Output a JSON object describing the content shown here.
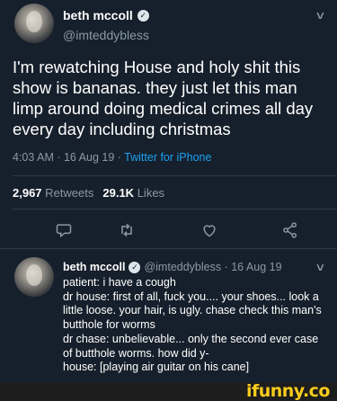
{
  "tweet": {
    "author_name": "beth mccoll",
    "handle": "@imteddybless",
    "text": "I'm rewatching House and holy shit this show is bananas. they just let this man limp around doing medical crimes all day every day including christmas",
    "time": "4:03 AM · 16 Aug 19 · ",
    "source": "Twitter for iPhone",
    "retweets_count": "2,967",
    "retweets_label": "Retweets",
    "likes_count": "29.1K",
    "likes_label": "Likes"
  },
  "reply": {
    "author_name": "beth mccoll",
    "handle_date": "@imteddybless · 16 Aug 19",
    "lines": [
      "patient: i have a cough",
      "dr house: first of all, fuck you.... your shoes... look a little loose. your hair, is ugly. chase check this man's butthole for worms",
      "dr chase: unbelievable... only the second ever case of butthole worms. how did y-",
      "house: [playing air guitar on his cane]"
    ]
  },
  "icons": {
    "verified": "verified-badge-icon",
    "chevron": "chevron-down-icon",
    "reply": "reply-icon",
    "retweet": "retweet-icon",
    "like": "heart-icon",
    "share": "share-icon"
  },
  "watermark": "ifunny.co",
  "colors": {
    "background": "#16202c",
    "link": "#1da1f2",
    "muted": "#8899a6",
    "watermark": "#f8cc1b"
  }
}
